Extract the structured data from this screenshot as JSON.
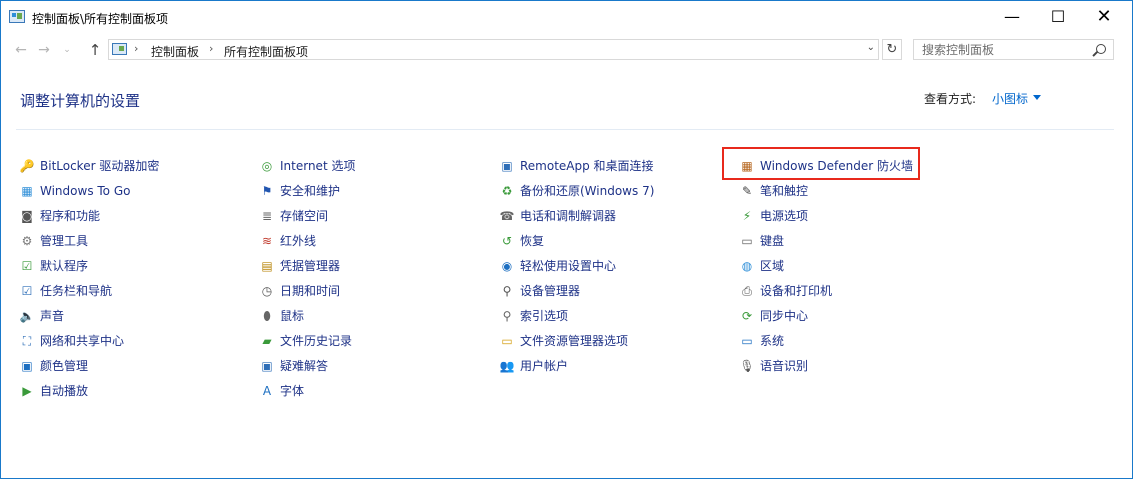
{
  "window": {
    "title": "控制面板\\所有控制面板项",
    "minimize_glyph": "—",
    "maximize_glyph": "☐",
    "close_glyph": "✕"
  },
  "address": {
    "back_glyph": "←",
    "forward_glyph": "→",
    "recent_glyph": "⌄",
    "up_glyph": "↑",
    "separator": "›",
    "crumbs": [
      "控制面板",
      "所有控制面板项"
    ],
    "dropdown_glyph": "⌄",
    "refresh_glyph": "↻",
    "search_placeholder": "搜索控制面板"
  },
  "header": {
    "title": "调整计算机的设置",
    "view_by_label": "查看方式:",
    "view_by_value": "小图标"
  },
  "colors": {
    "link": "#1e3287",
    "accent": "#0066cc",
    "highlight_border": "#e8291c",
    "window_border": "#1979ca"
  },
  "columns": [
    [
      {
        "label": "BitLocker 驱动器加密",
        "icon": "key-lock-icon",
        "glyph": "🔑",
        "color": "#c79a1e"
      },
      {
        "label": "Windows To Go",
        "icon": "windows-usb-icon",
        "glyph": "▦",
        "color": "#2f8fd8"
      },
      {
        "label": "程序和功能",
        "icon": "programs-icon",
        "glyph": "◙",
        "color": "#555555"
      },
      {
        "label": "管理工具",
        "icon": "admin-tools-icon",
        "glyph": "⚙",
        "color": "#777777"
      },
      {
        "label": "默认程序",
        "icon": "default-programs-icon",
        "glyph": "☑",
        "color": "#3a9a3a"
      },
      {
        "label": "任务栏和导航",
        "icon": "taskbar-icon",
        "glyph": "☑",
        "color": "#2f6fb8"
      },
      {
        "label": "声音",
        "icon": "speaker-icon",
        "glyph": "🔈",
        "color": "#666666"
      },
      {
        "label": "网络和共享中心",
        "icon": "network-icon",
        "glyph": "⛶",
        "color": "#2f6fb8"
      },
      {
        "label": "颜色管理",
        "icon": "color-management-icon",
        "glyph": "▣",
        "color": "#1d6fc1"
      },
      {
        "label": "自动播放",
        "icon": "autoplay-icon",
        "glyph": "▶",
        "color": "#3a9a3a"
      }
    ],
    [
      {
        "label": "Internet 选项",
        "icon": "internet-options-icon",
        "glyph": "◎",
        "color": "#3a9a3a"
      },
      {
        "label": "安全和维护",
        "icon": "flag-icon",
        "glyph": "⚑",
        "color": "#2256b0"
      },
      {
        "label": "存储空间",
        "icon": "storage-icon",
        "glyph": "≣",
        "color": "#666666"
      },
      {
        "label": "红外线",
        "icon": "infrared-icon",
        "glyph": "≋",
        "color": "#c0392b"
      },
      {
        "label": "凭据管理器",
        "icon": "credential-icon",
        "glyph": "▤",
        "color": "#b8860b"
      },
      {
        "label": "日期和时间",
        "icon": "clock-icon",
        "glyph": "◷",
        "color": "#555555"
      },
      {
        "label": "鼠标",
        "icon": "mouse-icon",
        "glyph": "⬮",
        "color": "#666666"
      },
      {
        "label": "文件历史记录",
        "icon": "file-history-icon",
        "glyph": "▰",
        "color": "#3a9a3a"
      },
      {
        "label": "疑难解答",
        "icon": "troubleshoot-icon",
        "glyph": "▣",
        "color": "#2f6fb8"
      },
      {
        "label": "字体",
        "icon": "font-icon",
        "glyph": "A",
        "color": "#1d6fc1"
      }
    ],
    [
      {
        "label": "RemoteApp 和桌面连接",
        "icon": "remoteapp-icon",
        "glyph": "▣",
        "color": "#2f6fb8"
      },
      {
        "label": "备份和还原(Windows 7)",
        "icon": "backup-icon",
        "glyph": "♻",
        "color": "#3a9a3a"
      },
      {
        "label": "电话和调制解调器",
        "icon": "phone-modem-icon",
        "glyph": "☎",
        "color": "#666666"
      },
      {
        "label": "恢复",
        "icon": "recovery-icon",
        "glyph": "↺",
        "color": "#3a9a3a"
      },
      {
        "label": "轻松使用设置中心",
        "icon": "ease-of-access-icon",
        "glyph": "◉",
        "color": "#1d6fc1"
      },
      {
        "label": "设备管理器",
        "icon": "device-manager-icon",
        "glyph": "⚲",
        "color": "#555555"
      },
      {
        "label": "索引选项",
        "icon": "indexing-icon",
        "glyph": "⚲",
        "color": "#666666"
      },
      {
        "label": "文件资源管理器选项",
        "icon": "folder-options-icon",
        "glyph": "▭",
        "color": "#d4a017"
      },
      {
        "label": "用户帐户",
        "icon": "user-accounts-icon",
        "glyph": "👥",
        "color": "#3a9a3a"
      }
    ],
    [
      {
        "label": "Windows Defender 防火墙",
        "icon": "firewall-icon",
        "glyph": "▦",
        "color": "#b5651d",
        "highlighted": true
      },
      {
        "label": "笔和触控",
        "icon": "pen-icon",
        "glyph": "✎",
        "color": "#444444"
      },
      {
        "label": "电源选项",
        "icon": "power-icon",
        "glyph": "⚡",
        "color": "#3a9a3a"
      },
      {
        "label": "键盘",
        "icon": "keyboard-icon",
        "glyph": "▭",
        "color": "#666666"
      },
      {
        "label": "区域",
        "icon": "globe-icon",
        "glyph": "◍",
        "color": "#2f8fd8"
      },
      {
        "label": "设备和打印机",
        "icon": "printer-icon",
        "glyph": "⎙",
        "color": "#555555"
      },
      {
        "label": "同步中心",
        "icon": "sync-icon",
        "glyph": "⟳",
        "color": "#3a9a3a"
      },
      {
        "label": "系统",
        "icon": "system-icon",
        "glyph": "▭",
        "color": "#1d6fc1"
      },
      {
        "label": "语音识别",
        "icon": "microphone-icon",
        "glyph": "🎙",
        "color": "#555555"
      }
    ]
  ]
}
